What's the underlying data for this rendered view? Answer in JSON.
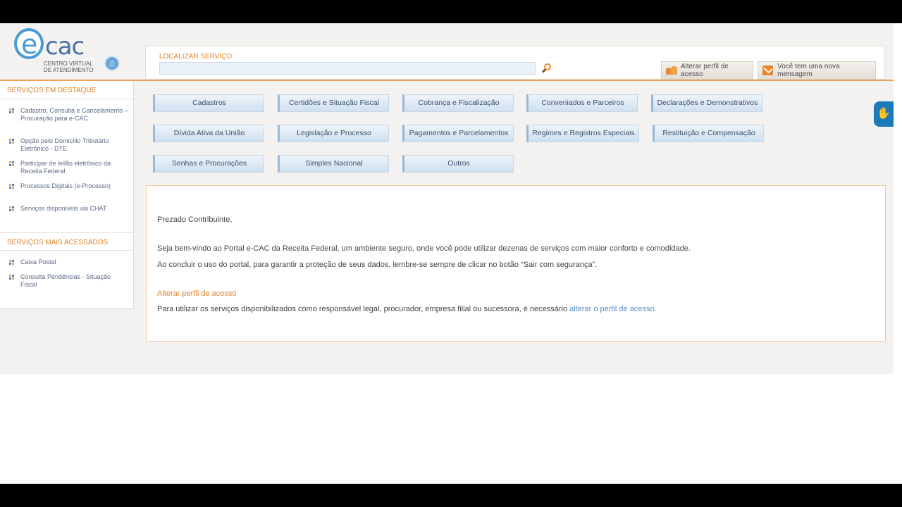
{
  "logo": {
    "e": "e",
    "cac": "cac",
    "sub_line1": "Centro Virtual",
    "sub_line2": "de Atendimento"
  },
  "header": {
    "search_label": "LOCALIZAR SERVIÇO",
    "search_value": "",
    "btn_perfil": "Alterar perfil de acesso",
    "btn_mensagem": "Você tem uma nova mensagem"
  },
  "sidebar": {
    "destaque_title": "SERVIÇOS EM DESTAQUE",
    "destaque_items": [
      {
        "label": "Cadastro, Consulta e Cancelamento – Procuração para e-CAC"
      },
      {
        "label": "Opção pelo Domicílio Tributário Eletrônico - DTE"
      },
      {
        "label": "Participar de leilão eletrônico da Receita Federal"
      },
      {
        "label": "Processos Digitais (e-Processo)"
      },
      {
        "label": "Serviços disponíveis via CHAT"
      }
    ],
    "acessados_title": "SERVIÇOS MAIS ACESSADOS",
    "acessados_items": [
      {
        "label": "Caixa Postal"
      },
      {
        "label": "Consulta Pendências - Situação Fiscal"
      }
    ]
  },
  "categories": {
    "cadastros": "Cadastros",
    "certidoes": "Certidões e Situação Fiscal",
    "cobranca": "Cobrança e Fiscalização",
    "conveniados": "Conveniados e Parceiros",
    "declaracoes": "Declarações e Demonstrativos",
    "divida": "Dívida Ativa da União",
    "legislacao": "Legislação e Processo",
    "pagamentos": "Pagamentos e Parcelamentos",
    "regimes": "Regimes e Registros Especiais",
    "restituicao": "Restituição e Compensação",
    "senhas": "Senhas e Procurações",
    "simples": "Simples Nacional",
    "outros": "Outros"
  },
  "content": {
    "greeting": "Prezado Contribuinte,",
    "welcome": "Seja bem-vindo ao Portal e-CAC da Receita Federal, um ambiente seguro, onde você pode utilizar dezenas de serviços com maior conforto e comodidade.",
    "logout_note": "Ao concluir o uso do portal, para garantir a proteção de seus dados, lembre-se sempre de clicar no botão “Sair com segurança”.",
    "perfil_title": "Alterar perfil de acesso",
    "perfil_text": "Para utilizar os serviços disponibilizados como responsável legal, procurador, empresa filial ou sucessora, é necessário ",
    "perfil_link": "alterar o perfil de acesso."
  }
}
